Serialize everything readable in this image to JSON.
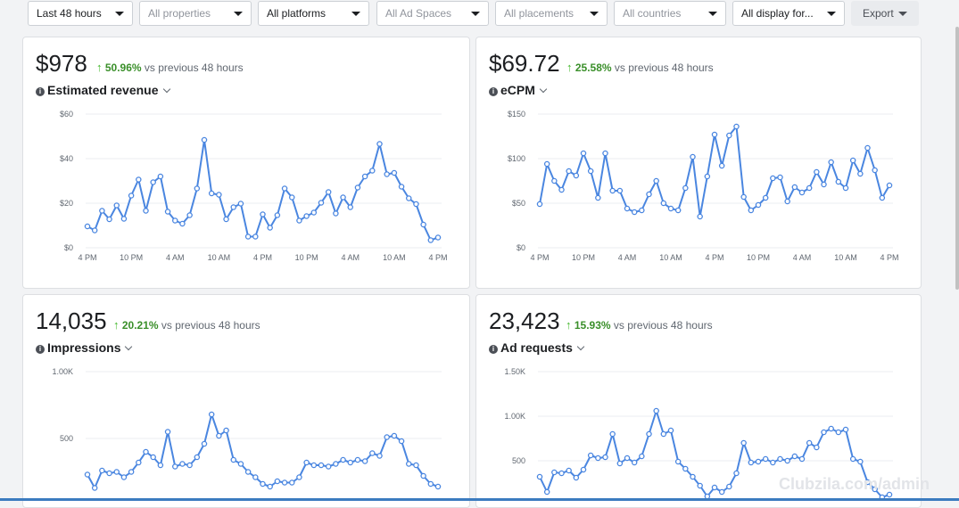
{
  "filters": [
    {
      "label": "Last 48 hours",
      "muted": false
    },
    {
      "label": "All properties",
      "muted": true
    },
    {
      "label": "All platforms",
      "muted": false
    },
    {
      "label": "All Ad Spaces",
      "muted": true
    },
    {
      "label": "All placements",
      "muted": true
    },
    {
      "label": "All countries",
      "muted": true
    },
    {
      "label": "All display for...",
      "muted": false
    }
  ],
  "export_label": "Export",
  "cards": [
    {
      "value": "$978",
      "pct": "50.96%",
      "vs": "vs previous 48 hours",
      "metric": "Estimated revenue",
      "chart_data": {
        "type": "line",
        "yticks": [
          "$0",
          "$20",
          "$40",
          "$60"
        ],
        "ylim": [
          0,
          60
        ],
        "xticks": [
          "4 PM",
          "10 PM",
          "4 AM",
          "10 AM",
          "4 PM",
          "10 PM",
          "4 AM",
          "10 AM",
          "4 PM"
        ],
        "color": "#4a86e0",
        "values": [
          9.6,
          7.8,
          16.6,
          12.8,
          19,
          13,
          23.4,
          30.6,
          16.6,
          29.4,
          32,
          16.2,
          12.2,
          10.8,
          14.6,
          26.6,
          48.4,
          24.4,
          23.8,
          12.8,
          18.2,
          19.8,
          5,
          5,
          15,
          9,
          14.6,
          26.6,
          22.6,
          12.2,
          14.2,
          15.8,
          20.2,
          25,
          15.4,
          22.6,
          18.2,
          27,
          32,
          34.6,
          46.6,
          33,
          33.6,
          27.4,
          22.2,
          19.6,
          10.4,
          3.4,
          4.6
        ]
      }
    },
    {
      "value": "$69.72",
      "pct": "25.58%",
      "vs": "vs previous 48 hours",
      "metric": "eCPM",
      "chart_data": {
        "type": "line",
        "yticks": [
          "$0",
          "$50",
          "$100",
          "$150"
        ],
        "ylim": [
          0,
          150
        ],
        "xticks": [
          "4 PM",
          "10 PM",
          "4 AM",
          "10 AM",
          "4 PM",
          "10 PM",
          "4 AM",
          "10 AM",
          "4 PM"
        ],
        "color": "#4a86e0",
        "values": [
          49,
          94,
          75,
          65,
          86,
          81,
          106,
          86,
          56,
          106,
          64,
          64,
          44,
          40,
          42,
          60,
          75,
          50,
          44,
          42,
          67,
          102,
          35,
          80,
          127,
          92,
          126,
          136,
          57,
          42,
          48,
          56,
          78,
          79,
          52,
          68,
          62,
          67,
          85,
          71,
          96,
          74,
          67,
          98,
          83,
          112,
          87,
          56,
          70
        ]
      }
    },
    {
      "value": "14,035",
      "pct": "20.21%",
      "vs": "vs previous 48 hours",
      "metric": "Impressions",
      "chart_data": {
        "type": "line",
        "yticks": [
          "500",
          "1.00K"
        ],
        "ylim": [
          0,
          1000
        ],
        "xticks": [],
        "color": "#4a86e0",
        "values": [
          230,
          130,
          260,
          240,
          250,
          210,
          250,
          320,
          400,
          360,
          300,
          550,
          290,
          310,
          300,
          360,
          460,
          680,
          520,
          560,
          340,
          310,
          250,
          210,
          160,
          140,
          180,
          170,
          170,
          210,
          320,
          300,
          300,
          290,
          310,
          340,
          320,
          340,
          330,
          390,
          370,
          510,
          520,
          480,
          310,
          300,
          220,
          160,
          140
        ]
      }
    },
    {
      "value": "23,423",
      "pct": "15.93%",
      "vs": "vs previous 48 hours",
      "metric": "Ad requests",
      "chart_data": {
        "type": "line",
        "yticks": [
          "500",
          "1.00K",
          "1.50K"
        ],
        "ylim": [
          0,
          1500
        ],
        "xticks": [],
        "color": "#4a86e0",
        "values": [
          320,
          150,
          370,
          360,
          390,
          310,
          400,
          560,
          530,
          540,
          800,
          470,
          530,
          480,
          550,
          800,
          1060,
          800,
          840,
          490,
          410,
          320,
          220,
          100,
          200,
          150,
          210,
          360,
          700,
          480,
          490,
          520,
          480,
          520,
          500,
          550,
          520,
          700,
          650,
          820,
          860,
          820,
          850,
          520,
          490,
          260,
          180,
          90,
          120
        ]
      }
    }
  ],
  "watermark": "Clubzila.com/admin"
}
